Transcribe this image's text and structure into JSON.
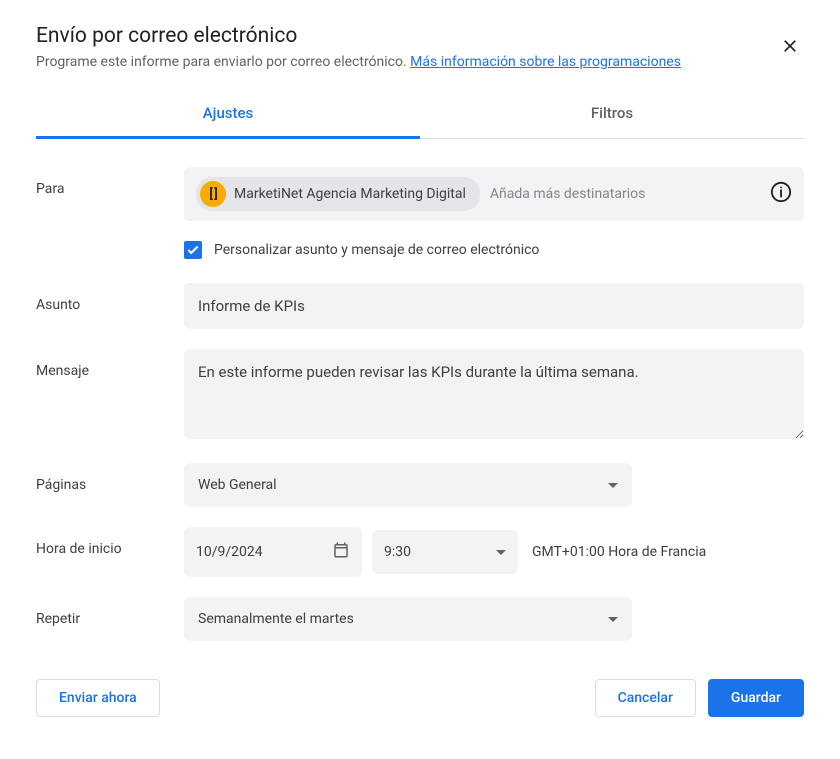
{
  "dialog": {
    "title": "Envío por correo electrónico",
    "subtitle_text": "Programe este informe para enviarlo por correo electrónico.",
    "subtitle_link": "Más información sobre las programaciones"
  },
  "tabs": {
    "settings": "Ajustes",
    "filters": "Filtros"
  },
  "labels": {
    "to": "Para",
    "subject": "Asunto",
    "message": "Mensaje",
    "pages": "Páginas",
    "start_time": "Hora de inicio",
    "repeat": "Repetir"
  },
  "recipients": {
    "chip_avatar_text": "[ ]",
    "chip_label": "MarketiNet Agencia Marketing Digital",
    "placeholder": "Añada más destinatarios"
  },
  "checkbox": {
    "label": "Personalizar asunto y mensaje de correo electrónico"
  },
  "fields": {
    "subject_value": "Informe de KPIs",
    "message_value": "En este informe pueden revisar las KPIs durante la última semana.",
    "pages_value": "Web General",
    "date_value": "10/9/2024",
    "time_value": "9:30",
    "timezone": "GMT+01:00 Hora de Francia",
    "repeat_value": "Semanalmente el martes"
  },
  "buttons": {
    "send_now": "Enviar ahora",
    "cancel": "Cancelar",
    "save": "Guardar"
  }
}
